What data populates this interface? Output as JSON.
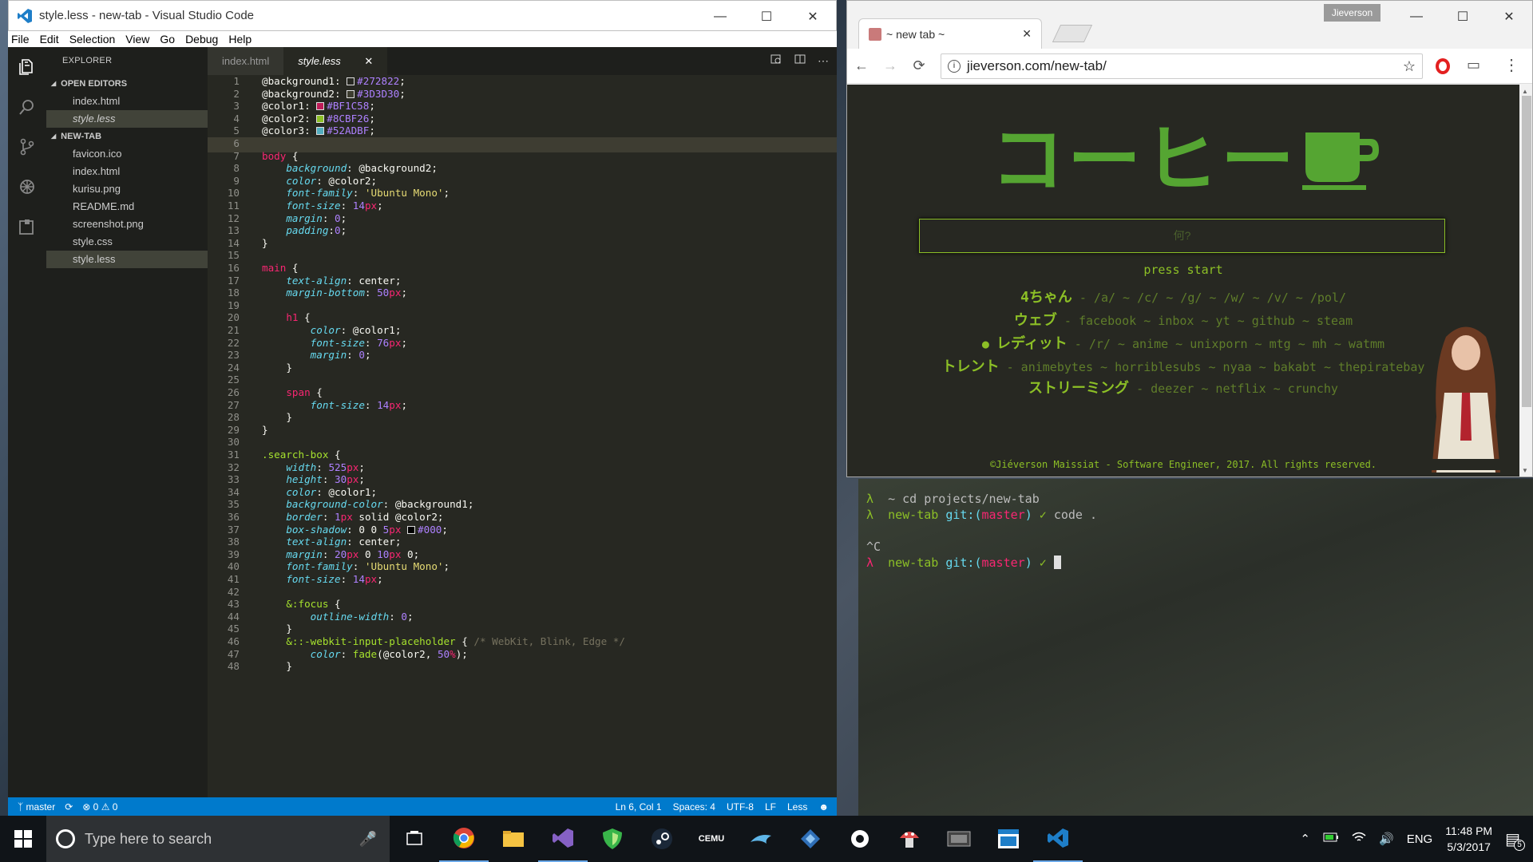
{
  "vscode": {
    "title": "style.less - new-tab - Visual Studio Code",
    "menu": [
      "File",
      "Edit",
      "Selection",
      "View",
      "Go",
      "Debug",
      "Help"
    ],
    "explorer": {
      "header": "EXPLORER",
      "open_editors_label": "OPEN EDITORS",
      "open_editors": [
        "index.html",
        "style.less"
      ],
      "project_label": "NEW-TAB",
      "files": [
        "favicon.ico",
        "index.html",
        "kurisu.png",
        "README.md",
        "screenshot.png",
        "style.css",
        "style.less"
      ]
    },
    "tabs": [
      "index.html",
      "style.less"
    ],
    "code": [
      "@background1: #272822;",
      "@background2: #3D3D30;",
      "@color1: #BF1C58;",
      "@color2: #8CBF26;",
      "@color3: #52ADBF;",
      "",
      "body {",
      "    background: @background2;",
      "    color: @color2;",
      "    font-family: 'Ubuntu Mono';",
      "    font-size: 14px;",
      "    margin: 0;",
      "    padding:0;",
      "}",
      "",
      "main {",
      "    text-align: center;",
      "    margin-bottom: 50px;",
      "",
      "    h1 {",
      "        color: @color1;",
      "        font-size: 76px;",
      "        margin: 0;",
      "    }",
      "",
      "    span {",
      "        font-size: 14px;",
      "    }",
      "}",
      "",
      ".search-box {",
      "    width: 525px;",
      "    height: 30px;",
      "    color: @color1;",
      "    background-color: @background1;",
      "    border: 1px solid @color2;",
      "    box-shadow: 0 0 5px #000;",
      "    text-align: center;",
      "    margin: 20px 0 10px 0;",
      "    font-family: 'Ubuntu Mono';",
      "    font-size: 14px;",
      "",
      "    &:focus {",
      "        outline-width: 0;",
      "    }",
      "    &::-webkit-input-placeholder { /* WebKit, Blink, Edge */",
      "        color: fade(@color2, 50%);",
      "    }"
    ],
    "swatches": [
      "#272822",
      "#3D3D30",
      "#BF1C58",
      "#8CBF26",
      "#52ADBF"
    ],
    "status": {
      "branch": "master",
      "problems": "⊗ 0 ⚠ 0",
      "position": "Ln 6, Col 1",
      "spaces": "Spaces: 4",
      "encoding": "UTF-8",
      "eol": "LF",
      "language": "Less"
    }
  },
  "chrome": {
    "tab_title": "~ new tab ~",
    "profile": "Jieverson",
    "url": "jieverson.com/new-tab/",
    "page": {
      "logo": "コーヒー",
      "search_placeholder": "何?",
      "press_start": "press start",
      "link_rows": [
        {
          "label": "4ちゃん",
          "items": "/a/ ~ /c/ ~ /g/ ~ /w/ ~ /v/ ~ /pol/"
        },
        {
          "label": "ウェブ",
          "items": "facebook ~ inbox ~ yt ~ github ~ steam"
        },
        {
          "label": "レディット",
          "items": "/r/ ~ anime ~ unixporn ~ mtg ~ mh ~ watmm"
        },
        {
          "label": "トレント",
          "items": "animebytes ~ horriblesubs ~ nyaa ~ bakabt ~ thepiratebay"
        },
        {
          "label": "ストリーミング",
          "items": "deezer ~ netflix ~ crunchy"
        }
      ],
      "footer": "©Jiéverson Maissiat - Software Engineer, 2017. All rights reserved."
    }
  },
  "terminal": {
    "lines": [
      {
        "prompt": "λ",
        "text": "~ cd projects/new-tab"
      },
      {
        "prompt": "λ",
        "dir": "new-tab",
        "git": "git:(",
        "branch": "master",
        "close": ")",
        "ok": "✓",
        "cmd": "code ."
      },
      {
        "prompt": "",
        "text": "^C"
      },
      {
        "prompt": "λ",
        "dir": "new-tab",
        "git": "git:(",
        "branch": "master",
        "close": ")",
        "ok": "✓",
        "cmd": ""
      }
    ]
  },
  "taskbar": {
    "search_placeholder": "Type here to search",
    "apps": [
      "task-view",
      "chrome",
      "file-explorer",
      "visual-studio",
      "vpn",
      "steam",
      "cemu",
      "dolphin",
      "app",
      "settings",
      "mushroom",
      "sega",
      "window",
      "vscode"
    ],
    "cemu_label": "CEMU",
    "lang": "ENG",
    "time": "11:48 PM",
    "date": "5/3/2017",
    "notifications": "5"
  }
}
